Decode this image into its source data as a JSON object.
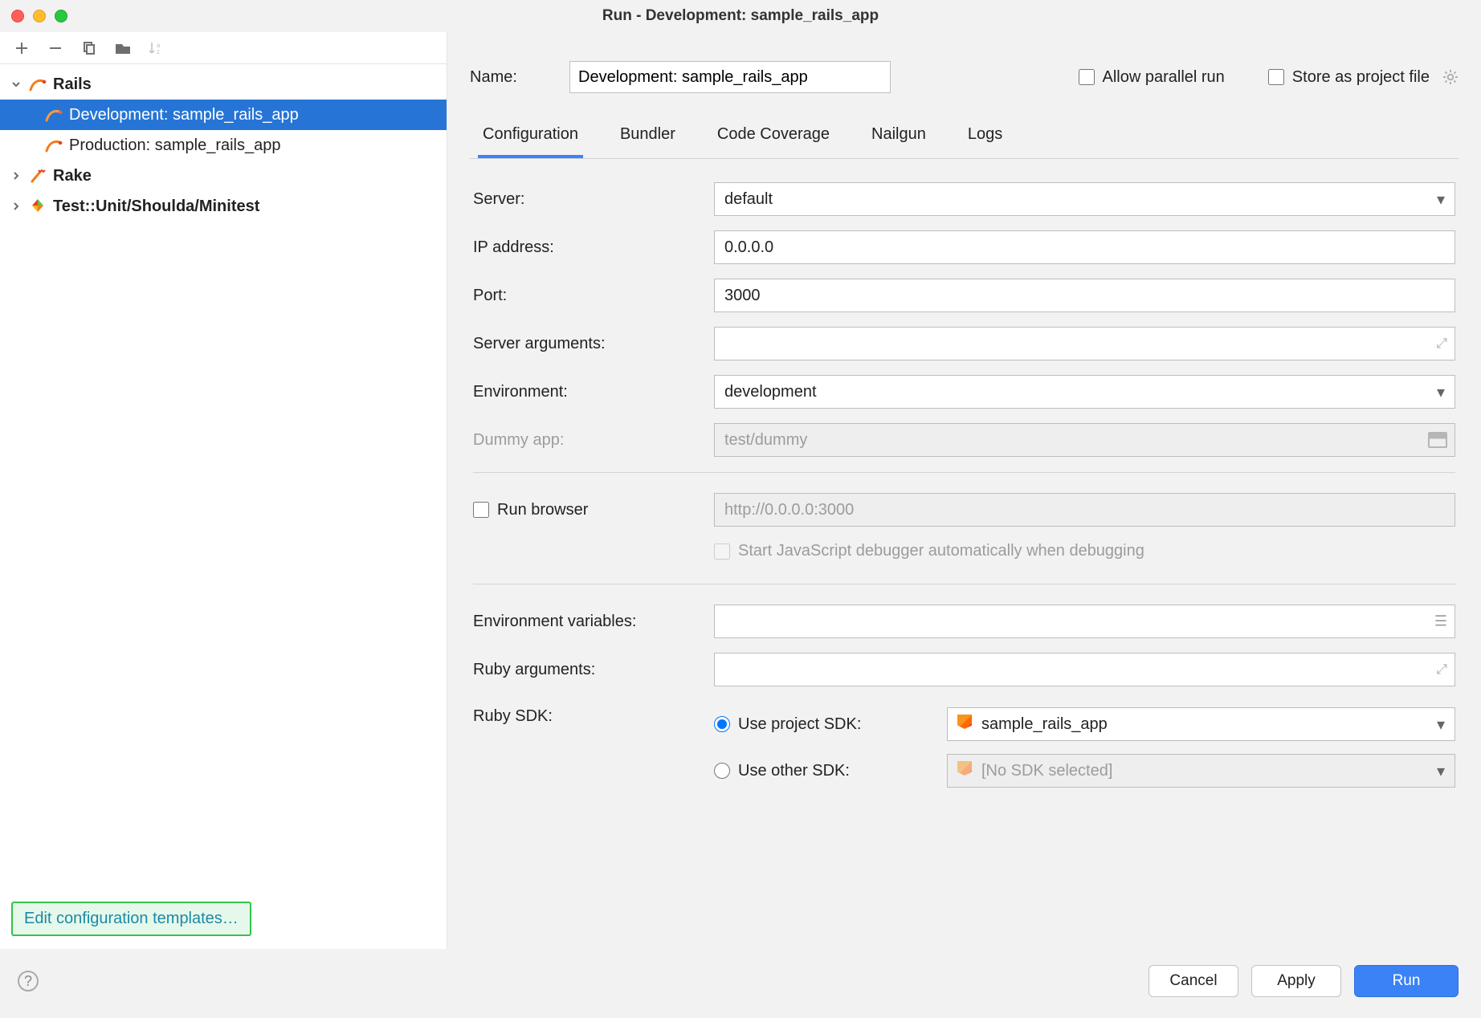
{
  "title": "Run - Development: sample_rails_app",
  "tree": {
    "rails": {
      "label": "Rails",
      "expanded": true
    },
    "rails_children": [
      {
        "label": "Development: sample_rails_app",
        "selected": true
      },
      {
        "label": "Production: sample_rails_app",
        "selected": false
      }
    ],
    "rake": {
      "label": "Rake",
      "expanded": false
    },
    "testunit": {
      "label": "Test::Unit/Shoulda/Minitest",
      "expanded": false
    }
  },
  "edit_templates_label": "Edit configuration templates…",
  "header": {
    "name_label": "Name:",
    "name_value": "Development: sample_rails_app",
    "allow_parallel_label": "Allow parallel run",
    "allow_parallel_checked": false,
    "store_as_file_label": "Store as project file",
    "store_as_file_checked": false
  },
  "tabs": [
    {
      "label": "Configuration",
      "active": true
    },
    {
      "label": "Bundler",
      "active": false
    },
    {
      "label": "Code Coverage",
      "active": false
    },
    {
      "label": "Nailgun",
      "active": false
    },
    {
      "label": "Logs",
      "active": false
    }
  ],
  "form": {
    "server": {
      "label": "Server:",
      "value": "default"
    },
    "ip": {
      "label": "IP address:",
      "value": "0.0.0.0"
    },
    "port": {
      "label": "Port:",
      "value": "3000"
    },
    "server_args": {
      "label": "Server arguments:",
      "value": ""
    },
    "environment": {
      "label": "Environment:",
      "value": "development"
    },
    "dummy_app": {
      "label": "Dummy app:",
      "value": "test/dummy",
      "disabled": true
    },
    "run_browser": {
      "label": "Run browser",
      "checked": false,
      "url": "http://0.0.0.0:3000",
      "js_debugger_label": "Start JavaScript debugger automatically when debugging",
      "js_debugger_checked": false
    },
    "env_vars": {
      "label": "Environment variables:",
      "value": ""
    },
    "ruby_args": {
      "label": "Ruby arguments:",
      "value": ""
    },
    "ruby_sdk": {
      "label": "Ruby SDK:",
      "project_sdk_label": "Use project SDK:",
      "project_sdk_selected": true,
      "project_sdk_value": "sample_rails_app",
      "other_sdk_label": "Use other SDK:",
      "other_sdk_value": "[No SDK selected]"
    }
  },
  "footer": {
    "cancel": "Cancel",
    "apply": "Apply",
    "run": "Run"
  }
}
